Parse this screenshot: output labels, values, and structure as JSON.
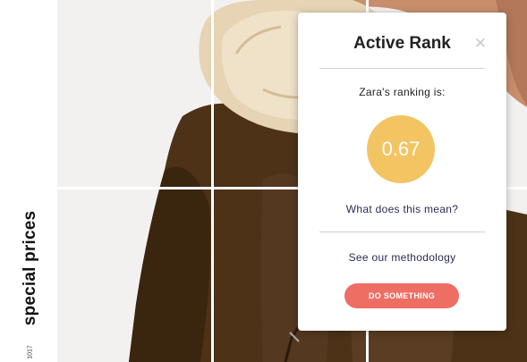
{
  "sidebar": {
    "vertical_label": "special prices",
    "small_code": "1017"
  },
  "popup": {
    "title": "Active Rank",
    "close_icon": "close-icon",
    "ranking_label": "Zara's ranking is:",
    "score": "0.67",
    "meaning_link": "What does this mean?",
    "methodology_link": "See our methodology",
    "action_button": "DO SOMETHING"
  },
  "colors": {
    "score_circle": "#f2c462",
    "action_button": "#ee6e64",
    "link_text": "#2b2a57"
  }
}
